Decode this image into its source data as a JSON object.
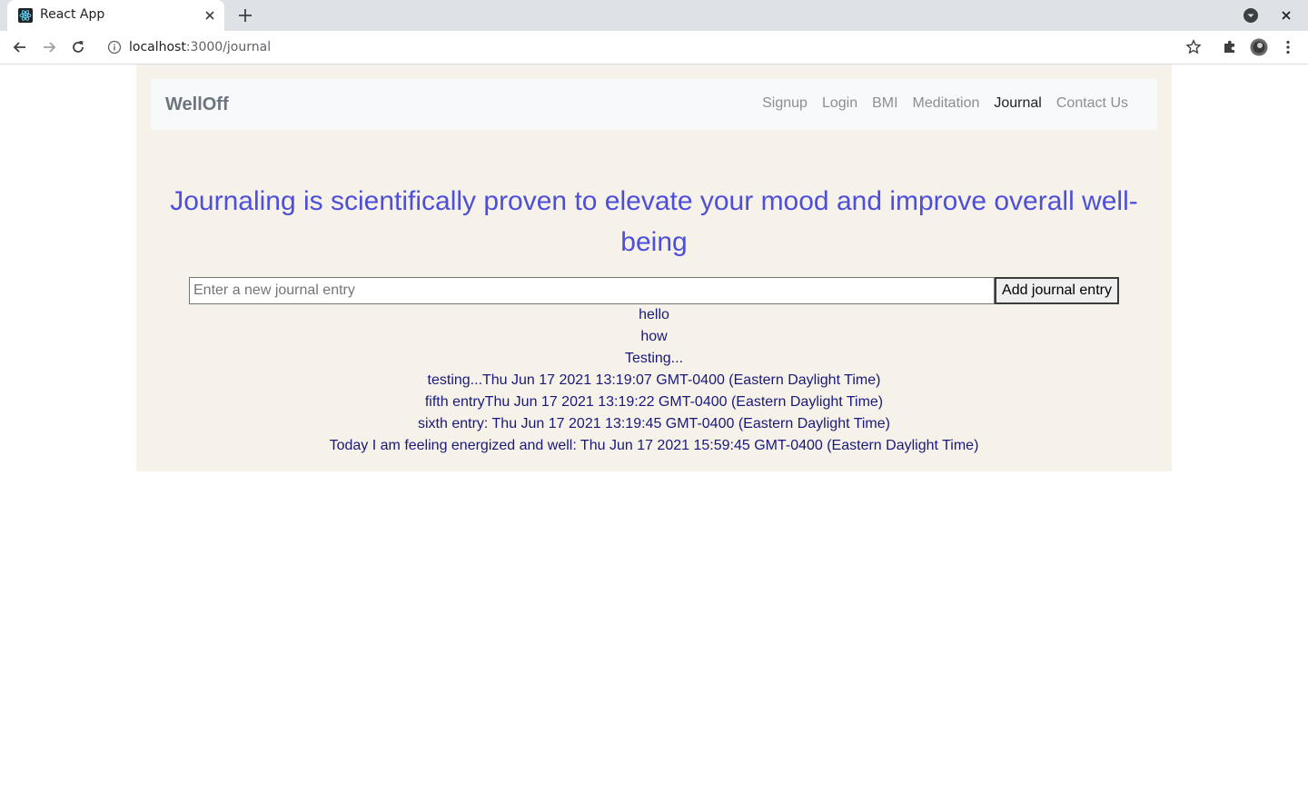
{
  "browser": {
    "tab_title": "React App",
    "url_host": "localhost",
    "url_path": ":3000/journal"
  },
  "navbar": {
    "brand": "WellOff",
    "links": [
      {
        "label": "Signup",
        "active": false
      },
      {
        "label": "Login",
        "active": false
      },
      {
        "label": "BMI",
        "active": false
      },
      {
        "label": "Meditation",
        "active": false
      },
      {
        "label": "Journal",
        "active": true
      },
      {
        "label": "Contact Us",
        "active": false
      }
    ]
  },
  "journal": {
    "headline": "Journaling is scientifically proven to elevate your mood and improve overall well-being",
    "input_placeholder": "Enter a new journal entry",
    "input_value": "",
    "add_button_label": "Add journal entry",
    "entries": [
      "hello",
      "how",
      "Testing...",
      "testing...Thu Jun 17 2021 13:19:07 GMT-0400 (Eastern Daylight Time)",
      "fifth entryThu Jun 17 2021 13:19:22 GMT-0400 (Eastern Daylight Time)",
      "sixth entry: Thu Jun 17 2021 13:19:45 GMT-0400 (Eastern Daylight Time)",
      "Today I am feeling energized and well: Thu Jun 17 2021 15:59:45 GMT-0400 (Eastern Daylight Time)"
    ]
  },
  "colors": {
    "page_background": "#f6f2ea",
    "headline": "#4d4fd9",
    "entry_text": "#19197a",
    "navbar_background": "#f8f9fa"
  }
}
